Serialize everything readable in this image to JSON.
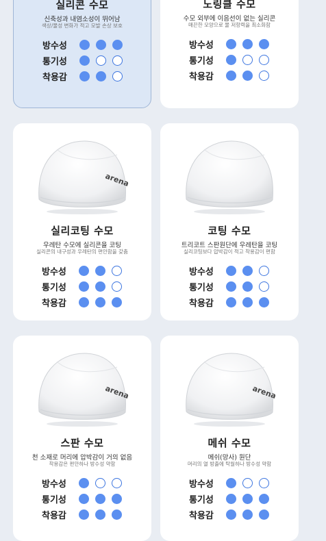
{
  "colors": {
    "dot_on": "#5b8ff0",
    "dot_outline": "#3b74df",
    "selected_bg": "#dce7f6"
  },
  "rating_labels": [
    "방수성",
    "통기성",
    "착용감"
  ],
  "cards": [
    {
      "title": "실리콘 수모",
      "subtitle": "신축성과 내염소성이 뛰어남",
      "description": "색상/물성 변화가 적고 모발 손상 보호",
      "ratings": [
        3,
        1,
        2
      ],
      "selected": true,
      "cap_icon": "swim-cap-icon",
      "brand_print": ""
    },
    {
      "title": "노링클 수모",
      "subtitle": "수모 외부에 이음선이 없는 실리콘",
      "description": "매끈한 모양으로 물 저항력을 최소화함",
      "ratings": [
        3,
        1,
        2
      ],
      "selected": false,
      "cap_icon": "swim-cap-icon",
      "brand_print": ""
    },
    {
      "title": "실리코팅 수모",
      "subtitle": "우레탄 수모에 실리콘을 코팅",
      "description": "실리콘의 내구성과 우레탄의 편안함을 갖춤",
      "ratings": [
        2,
        2,
        3
      ],
      "selected": false,
      "cap_icon": "swim-cap-icon",
      "brand_print": "arena"
    },
    {
      "title": "코팅 수모",
      "subtitle": "트리코트 스판원단에 우레탄을 코팅",
      "description": "실리코팅보다 압박감이 적고 착용감이 편함",
      "ratings": [
        2,
        2,
        3
      ],
      "selected": false,
      "cap_icon": "swim-cap-icon",
      "brand_print": ""
    },
    {
      "title": "스판 수모",
      "subtitle": "천 소재로 머리에 압박감이 거의 없음",
      "description": "착용감은 편안하나 방수성 약함",
      "ratings": [
        1,
        3,
        3
      ],
      "selected": false,
      "cap_icon": "swim-cap-icon",
      "brand_print": "arena"
    },
    {
      "title": "메쉬 수모",
      "subtitle": "메쉬(망사) 원단",
      "description": "머리의 열 방출에 탁월하나 방수성 약함",
      "ratings": [
        1,
        3,
        3
      ],
      "selected": false,
      "cap_icon": "swim-cap-icon",
      "brand_print": "arena"
    }
  ]
}
